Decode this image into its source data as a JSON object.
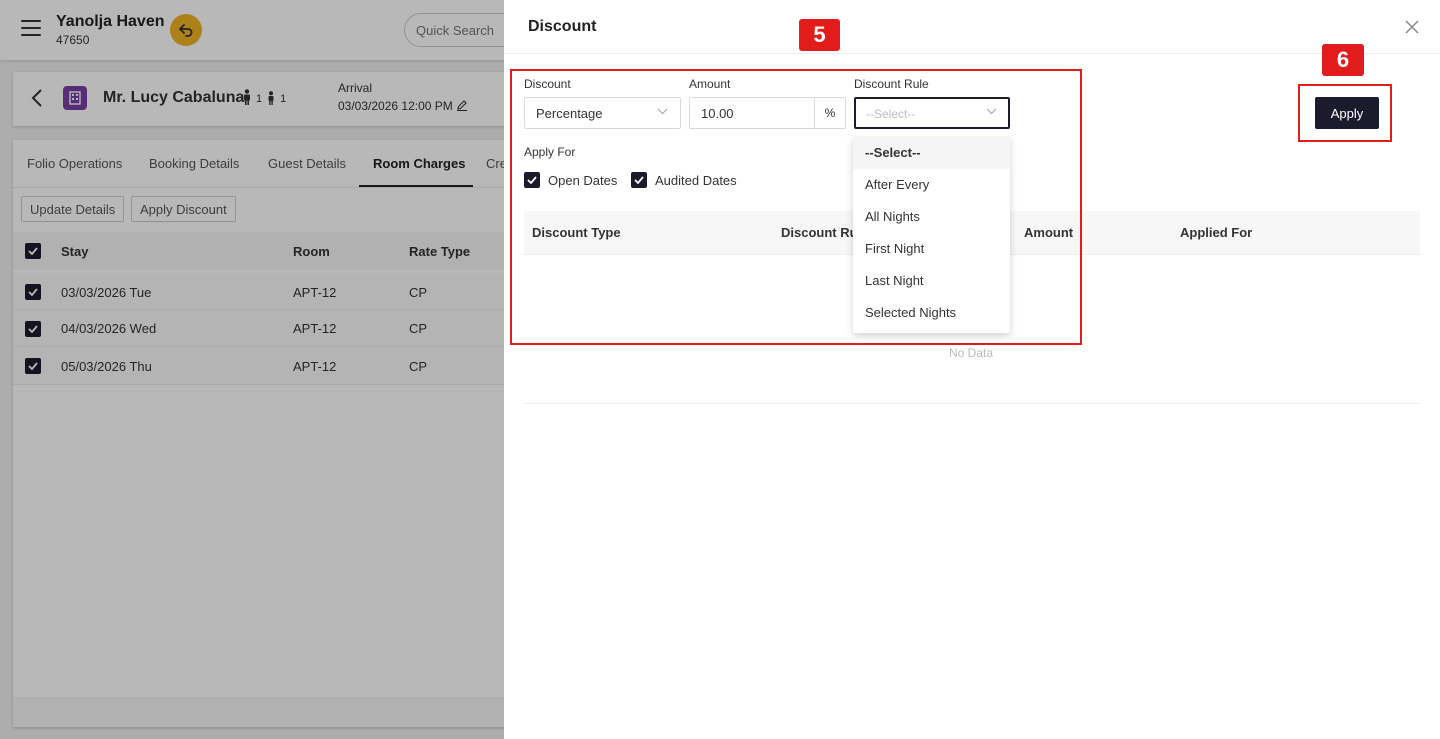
{
  "app": {
    "hotel_name": "Yanolja Haven",
    "hotel_code": "47650",
    "quick_search_placeholder": "Quick Search"
  },
  "guest": {
    "name": "Mr. Lucy Cabaluna",
    "adults": "1",
    "children": "1",
    "arrival_label": "Arrival",
    "arrival_date": "03/03/2026",
    "arrival_time": "12:00 PM"
  },
  "tabs": [
    {
      "label": "Folio Operations"
    },
    {
      "label": "Booking Details"
    },
    {
      "label": "Guest Details"
    },
    {
      "label": "Room Charges",
      "active": true
    },
    {
      "label": "Cre"
    }
  ],
  "actions": {
    "update_details": "Update Details",
    "apply_discount": "Apply Discount"
  },
  "stay_table": {
    "headers": [
      "Stay",
      "Room",
      "Rate Type"
    ],
    "rows": [
      {
        "stay": "03/03/2026 Tue",
        "room": "APT-12",
        "rate_type": "CP"
      },
      {
        "stay": "04/03/2026 Wed",
        "room": "APT-12",
        "rate_type": "CP"
      },
      {
        "stay": "05/03/2026 Thu",
        "room": "APT-12",
        "rate_type": "CP"
      }
    ]
  },
  "drawer": {
    "title": "Discount",
    "discount_label": "Discount",
    "discount_value": "Percentage",
    "amount_label": "Amount",
    "amount_value": "10.00",
    "amount_suffix": "%",
    "rule_label": "Discount Rule",
    "rule_placeholder": "--Select--",
    "apply_for_label": "Apply For",
    "open_dates_label": "Open Dates",
    "audited_dates_label": "Audited Dates",
    "apply_button": "Apply",
    "grid_headers": [
      "Discount Type",
      "Discount Rule",
      "Amount",
      "Applied For"
    ],
    "no_data": "No Data",
    "rule_options": [
      "--Select--",
      "After Every",
      "All Nights",
      "First Night",
      "Last Night",
      "Selected Nights"
    ]
  },
  "annotations": {
    "badge_5": "5",
    "badge_6": "6",
    "color": "#e21b1b"
  },
  "colors": {
    "primary": "#1c1b2e",
    "accent_yellow": "#f0b323",
    "building_purple": "#7b3fa5"
  }
}
